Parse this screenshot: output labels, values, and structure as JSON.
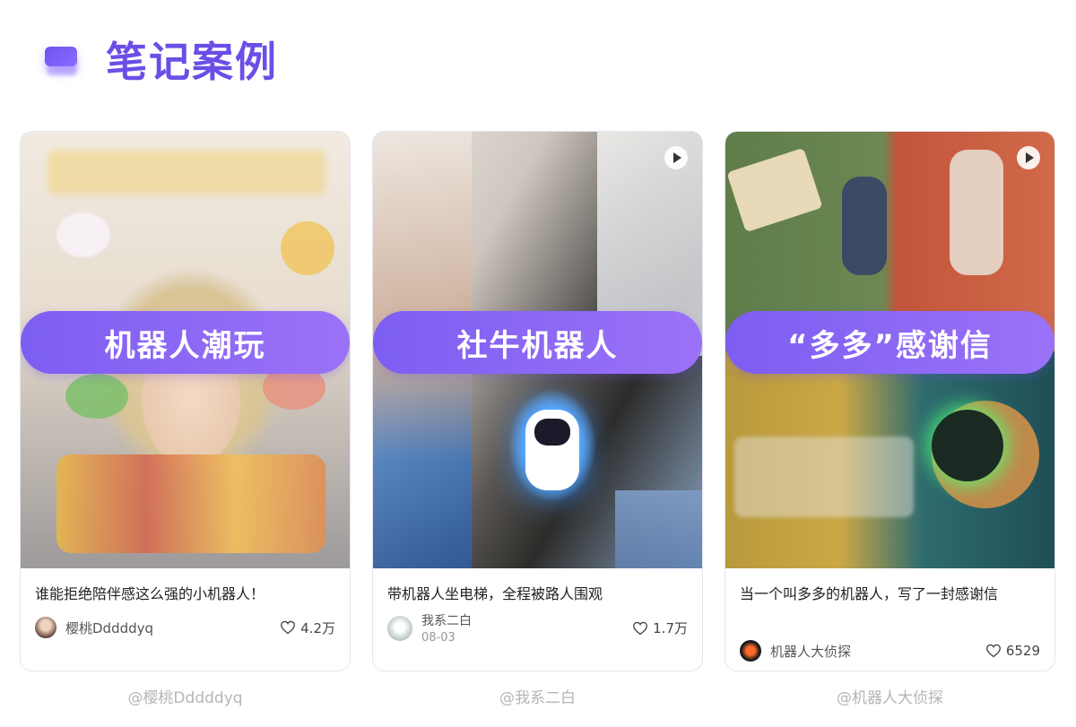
{
  "header": {
    "title": "笔记案例"
  },
  "cards": [
    {
      "pill": "机器人潮玩",
      "caption": "谁能拒绝陪伴感这么强的小机器人！",
      "author": "樱桃Dddddyq",
      "date": "",
      "likes": "4.2万",
      "credit": "@樱桃Dddddyq"
    },
    {
      "pill": "社牛机器人",
      "caption": "带机器人坐电梯，全程被路人围观",
      "author": "我系二白",
      "date": "08-03",
      "likes": "1.7万",
      "credit": "@我系二白"
    },
    {
      "pill": "“多多”感谢信",
      "caption": "当一个叫多多的机器人，写了一封感谢信",
      "author": "机器人大侦探",
      "date": "",
      "likes": "6529",
      "credit": "@机器人大侦探"
    }
  ],
  "colors": {
    "accent": "#6b4ee6",
    "pill_start": "#7c5ef2",
    "pill_end": "#9b72f7"
  }
}
